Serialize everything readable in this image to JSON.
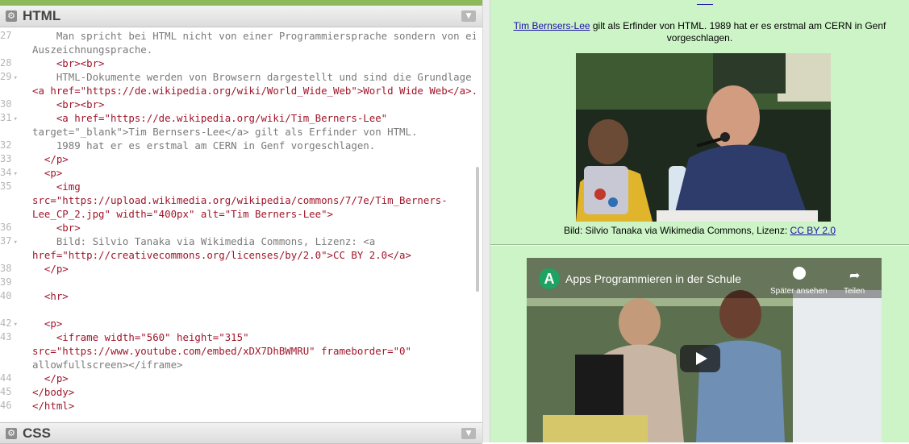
{
  "editor": {
    "html_panel_title": "HTML",
    "css_panel_title": "CSS",
    "collapse_icon": "chevron-down-icon",
    "panel_icon": "gear-icon",
    "line_numbers": [
      "27",
      "28",
      "29",
      "30",
      "31",
      "32",
      "33",
      "34",
      "35",
      "36",
      "37",
      "38",
      "39",
      "40",
      "42",
      "43",
      "44",
      "45",
      "46"
    ],
    "lines": [
      "    Man spricht bei HTML nicht von einer Programmiersprache sondern von einer",
      "Auszeichnungsprache.",
      "    <br><br>",
      "    HTML-Dokumente werden von Browsern dargestellt und sind die Grundlage des",
      "<a href=\"https://de.wikipedia.org/wiki/World_Wide_Web\">World Wide Web</a>.",
      "    <br><br>",
      "    <a href=\"https://de.wikipedia.org/wiki/Tim_Berners-Lee\"",
      "target=\"_blank\">Tim Bernsers-Lee</a> gilt als Erfinder von HTML.",
      "    1989 hat er es erstmal am CERN in Genf vorgeschlagen.",
      "  </p>",
      "  <p>",
      "    <img",
      "src=\"https://upload.wikimedia.org/wikipedia/commons/7/7e/Tim_Berners-",
      "Lee_CP_2.jpg\" width=\"400px\" alt=\"Tim Berners-Lee\">",
      "    <br>",
      "    Bild: Silvio Tanaka via Wikimedia Commons, Lizenz: <a",
      "href=\"http://creativecommons.org/licenses/by/2.0\">CC BY 2.0</a>",
      "  </p>",
      "",
      "  <hr>",
      "",
      "  <p>",
      "    <iframe width=\"560\" height=\"315\"",
      "src=\"https://www.youtube.com/embed/xDX7DhBWMRU\" frameborder=\"0\"",
      "allowfullscreen></iframe>",
      "  </p>",
      "</body>",
      "</html>"
    ]
  },
  "preview": {
    "link_text": "Tim Bernsers-Lee",
    "paragraph_rest": " gilt als Erfinder von HTML. 1989 hat er es erstmal am CERN in Genf vorgeschlagen.",
    "caption_text": "Bild: Silvio Tanaka via Wikimedia Commons, Lizenz: ",
    "caption_link": "CC BY 2.0",
    "video_title": "Apps Programmieren in der Schule",
    "video_logo_letter": "A",
    "watch_later": "Später ansehen",
    "share": "Teilen",
    "play_icon": "play-icon",
    "clock_icon": "clock-icon",
    "share_icon": "share-icon"
  }
}
